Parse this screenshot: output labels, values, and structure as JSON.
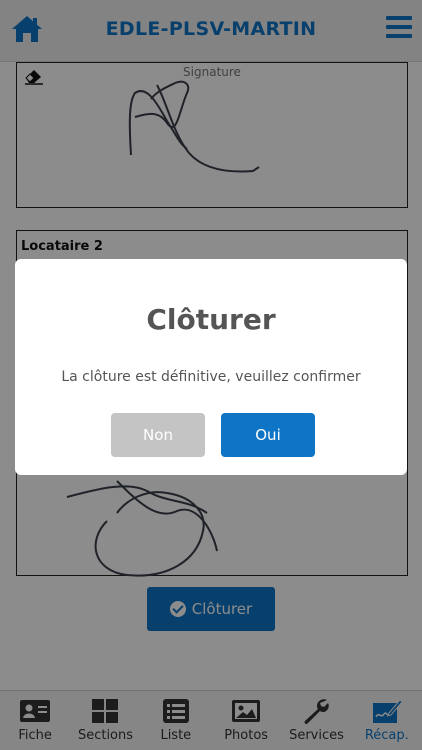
{
  "header": {
    "title": "EDLE-PLSV-MARTIN",
    "home_icon": "home-icon",
    "menu_icon": "menu-icon"
  },
  "signature_box": {
    "label": "Signature",
    "eraser_icon": "eraser-icon"
  },
  "locataire": {
    "label": "Locataire 2"
  },
  "cloturer_button": {
    "label": "Clôturer",
    "icon": "check-circle-icon"
  },
  "modal": {
    "title": "Clôturer",
    "message": "La clôture est définitive, veuillez confirmer",
    "cancel_label": "Non",
    "confirm_label": "Oui"
  },
  "tabs": [
    {
      "label": "Fiche",
      "icon": "id-card-icon",
      "active": false
    },
    {
      "label": "Sections",
      "icon": "grid-icon",
      "active": false
    },
    {
      "label": "Liste",
      "icon": "list-icon",
      "active": false
    },
    {
      "label": "Photos",
      "icon": "image-icon",
      "active": false
    },
    {
      "label": "Services",
      "icon": "wrench-icon",
      "active": false
    },
    {
      "label": "Récap.",
      "icon": "signature-icon",
      "active": true
    }
  ],
  "colors": {
    "accent": "#0e74c6",
    "cancel": "#c4c4c4",
    "overlay": "rgba(0,0,0,0.45)"
  }
}
